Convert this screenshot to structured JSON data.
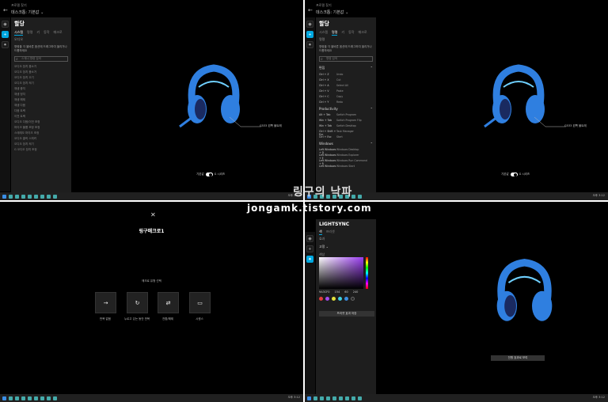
{
  "app": {
    "breadcrumb": "프로필 찾기",
    "profile": "데스크톱: 기본값 ⌄",
    "back": "←"
  },
  "q1": {
    "title": "할당",
    "tabs": [
      "시스템",
      "명령",
      "키",
      "동작",
      "매크로"
    ],
    "sub": "오디오",
    "desc": "명령을 각 올바른 옵션에 드래그하여 올리거나 드롭하세요",
    "search_placeholder": "스캐너 명령 검색",
    "items": [
      "오디오 장치 음소거",
      "오디오 장치 음소거",
      "오디오 장치 끄기",
      "오디오 장치 켜기",
      "재생 중지",
      "재생 정지",
      "재생 해제",
      "재생 다음",
      "다음 트랙",
      "이전 트랙",
      "오디오 다음/이전 조정",
      "마이크 볼륨 조정 조정",
      "스테레오 마이크 조정",
      "오디오 클릭 스피커",
      "오디오 장치 켜기",
      "G 오디오 장치 조정"
    ]
  },
  "q2": {
    "title": "할당",
    "tabs": [
      "시스템",
      "명령",
      "키",
      "동작",
      "매크로"
    ],
    "sub": "명령",
    "desc": "명령을 각 올바른 옵션에 드래그하여 올리거나 드롭하세요",
    "search_placeholder": "명령 검색",
    "sections": [
      {
        "name": "편집",
        "rows": [
          [
            "Ctrl + Z",
            "Undo"
          ],
          [
            "Ctrl + X",
            "Cut"
          ],
          [
            "Ctrl + A",
            "Select All"
          ],
          [
            "Ctrl + V",
            "Paste"
          ],
          [
            "Ctrl + C",
            "Copy"
          ],
          [
            "Ctrl + Y",
            "Redo"
          ]
        ]
      },
      {
        "name": "Productivity",
        "rows": [
          [
            "Alt + Tab",
            "Switch Program"
          ],
          [
            "Win + Tab",
            "Switch Program Flip"
          ],
          [
            "Win + Tab",
            "Switch Desktop"
          ],
          [
            "Ctrl + Shift + Esc",
            "Task Manager"
          ],
          [
            "Ctrl + Esc",
            "Start"
          ]
        ]
      },
      {
        "name": "Windows",
        "rows": [
          [
            "Left Windows + D",
            "Windows Desktop"
          ],
          [
            "Left Windows + E",
            "Windows Explorer"
          ],
          [
            "Left Windows + R",
            "Windows Run Command"
          ],
          [
            "Left Windows",
            "Windows Start"
          ]
        ]
      }
    ]
  },
  "scene": {
    "callout": "G533 왼쪽 볼트래",
    "toggle_label": "기본값",
    "toggle_right": "G 시리즈"
  },
  "q3": {
    "close": "✕",
    "title": "링구매크로1",
    "prompt": "매크로 유형 선택",
    "options": [
      {
        "icon": "→",
        "label": "반복 없음"
      },
      {
        "icon": "↻",
        "label": "누르고 있는 동안 반복"
      },
      {
        "icon": "⇄",
        "label": "전환/해제"
      },
      {
        "icon": "▭",
        "label": "시퀀스"
      }
    ]
  },
  "q4": {
    "title": "LIGHTSYNC",
    "tabs": [
      "색",
      "프리셋"
    ],
    "mode_label": "효과",
    "mode_value": "고정 ⌄",
    "color_label": "색상",
    "hex": "9A3CF0",
    "rgb": [
      "154",
      "60",
      "240"
    ],
    "swatches": [
      "#e23c3c",
      "#a34bf0",
      "#e2e23c",
      "#3cd0e2",
      "#3c8ee2",
      "#2a2a2a"
    ],
    "preset_button": "프리셋 효과 저장",
    "apply_button": "전원 효과로 보여"
  },
  "taskbar": {
    "clock": "오후 3:12"
  },
  "watermark": {
    "line1": "링구의 낙파",
    "line2": "jongamk.tistory.com"
  },
  "colors": {
    "accent": "#00a8e0",
    "headset": "#2f7fe0",
    "panel": "#1e1e1e"
  }
}
